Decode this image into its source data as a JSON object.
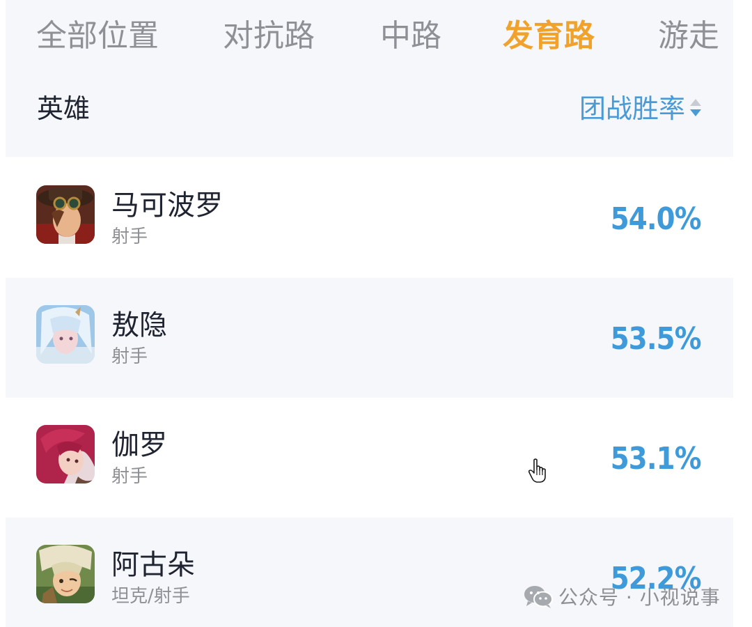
{
  "tabs": [
    {
      "label": "全部位置",
      "active": false
    },
    {
      "label": "对抗路",
      "active": false
    },
    {
      "label": "中路",
      "active": false
    },
    {
      "label": "发育路",
      "active": true
    },
    {
      "label": "游走",
      "active": false
    }
  ],
  "table": {
    "header_left": "英雄",
    "header_right": "团战胜率",
    "sort_icon": "sort-updown-icon"
  },
  "heroes": [
    {
      "name": "马可波罗",
      "role": "射手",
      "win_rate": "54.0%"
    },
    {
      "name": "敖隐",
      "role": "射手",
      "win_rate": "53.5%"
    },
    {
      "name": "伽罗",
      "role": "射手",
      "win_rate": "53.1%"
    },
    {
      "name": "阿古朵",
      "role": "坦克/射手",
      "win_rate": "52.2%"
    }
  ],
  "watermark": {
    "text": "公众号 · 小视说事",
    "icon": "wechat-icon"
  },
  "colors": {
    "active_tab": "#f0a22b",
    "inactive_tab": "#8e9096",
    "accent_blue": "#3e9ad8",
    "panel_bg": "#f6f7fb"
  }
}
